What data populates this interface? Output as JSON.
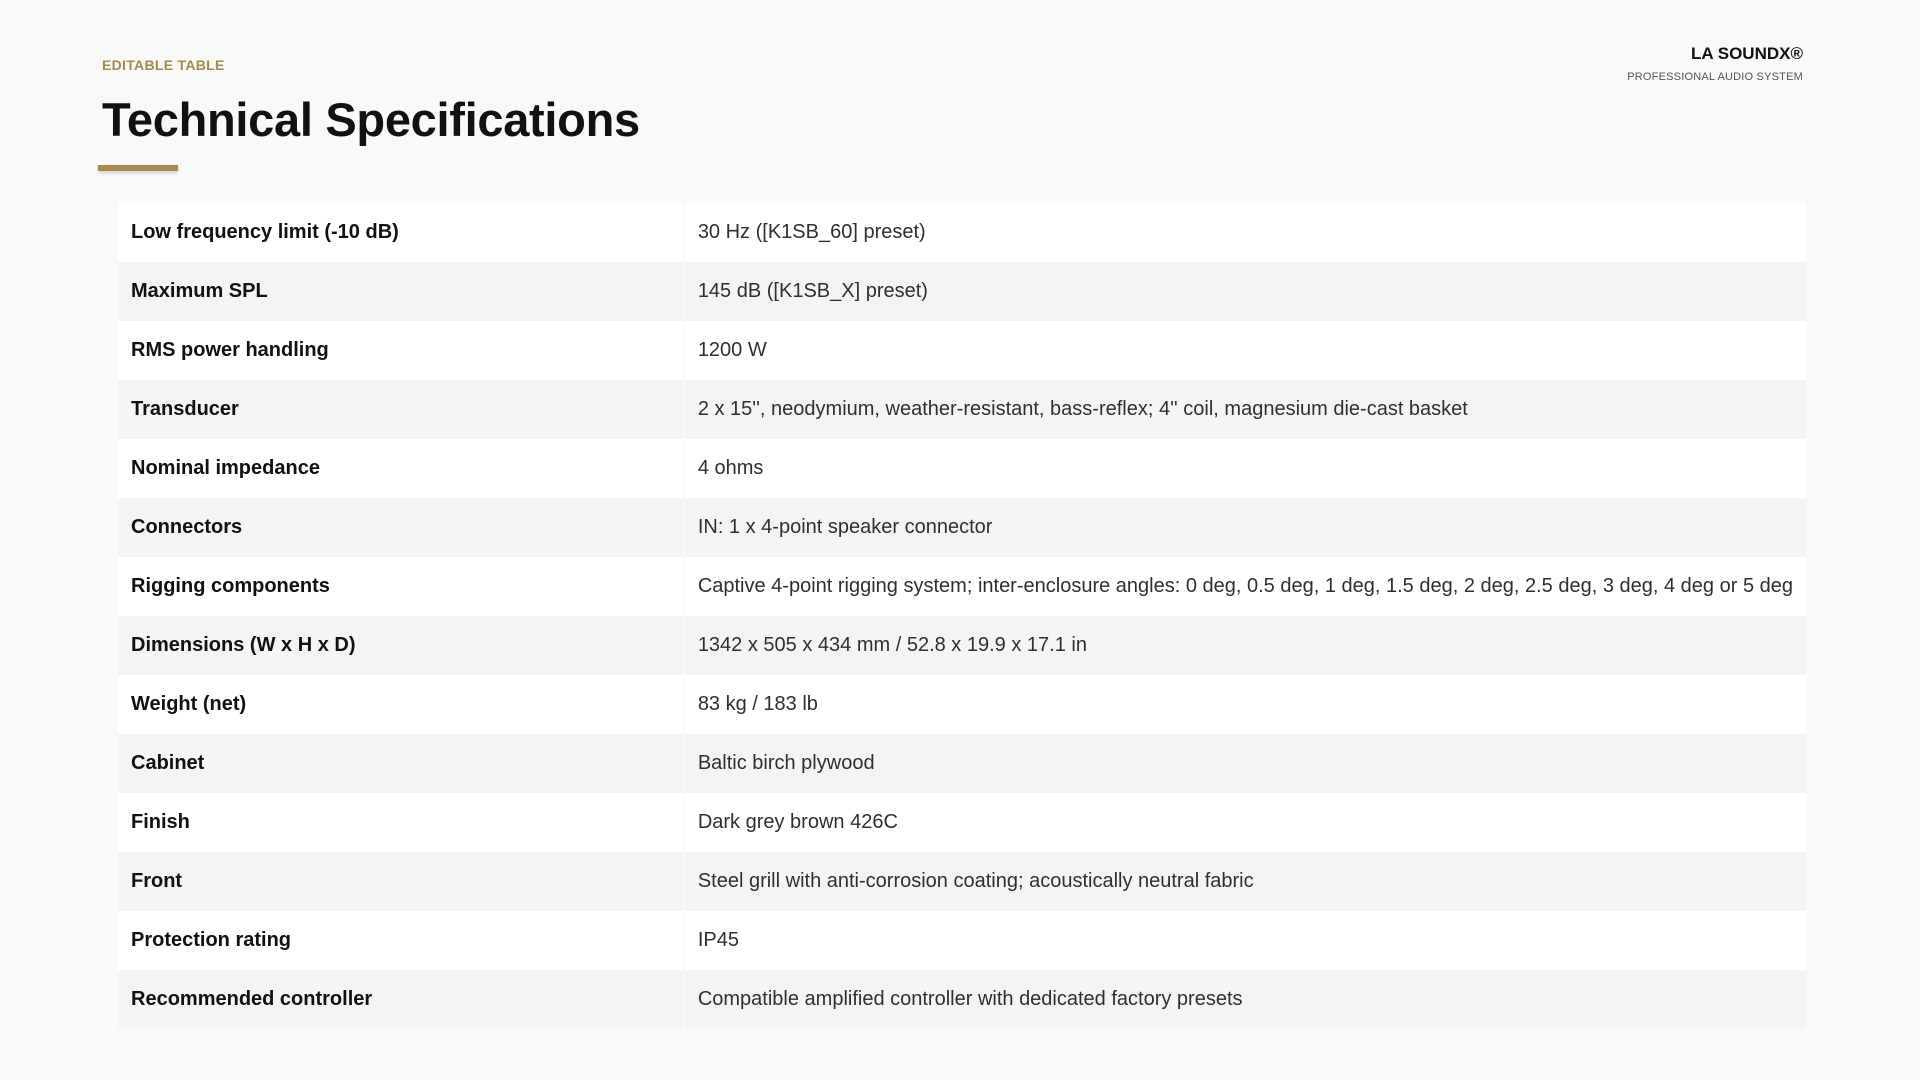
{
  "header": {
    "eyebrow": "EDITABLE TABLE",
    "title": "Technical Specifications",
    "accent_color": "#a8884f"
  },
  "brand": {
    "name": "LA SOUNDX®",
    "tagline": "PROFESSIONAL AUDIO SYSTEM"
  },
  "specs": {
    "rows": [
      {
        "label": "Low frequency limit (-10 dB)",
        "value": "30 Hz ([K1SB_60] preset)"
      },
      {
        "label": "Maximum SPL",
        "value": "145 dB ([K1SB_X] preset)"
      },
      {
        "label": "RMS power handling",
        "value": "1200 W"
      },
      {
        "label": "Transducer",
        "value": "2 x 15'', neodymium, weather-resistant, bass-reflex; 4'' coil, magnesium die-cast basket"
      },
      {
        "label": "Nominal impedance",
        "value": "4 ohms"
      },
      {
        "label": "Connectors",
        "value": "IN: 1 x 4-point speaker connector"
      },
      {
        "label": "Rigging components",
        "value": "Captive 4-point rigging system; inter-enclosure angles: 0 deg, 0.5 deg, 1 deg, 1.5 deg, 2 deg, 2.5 deg, 3 deg, 4 deg or 5 deg"
      },
      {
        "label": "Dimensions (W x H x D)",
        "value": "1342 x 505 x 434 mm / 52.8 x 19.9 x 17.1 in"
      },
      {
        "label": "Weight (net)",
        "value": "83 kg / 183 lb"
      },
      {
        "label": "Cabinet",
        "value": "Baltic birch plywood"
      },
      {
        "label": "Finish",
        "value": "Dark grey brown 426C"
      },
      {
        "label": "Front",
        "value": "Steel grill with anti-corrosion coating; acoustically neutral fabric"
      },
      {
        "label": "Protection rating",
        "value": "IP45"
      },
      {
        "label": "Recommended controller",
        "value": "Compatible amplified controller with dedicated factory presets"
      }
    ]
  }
}
